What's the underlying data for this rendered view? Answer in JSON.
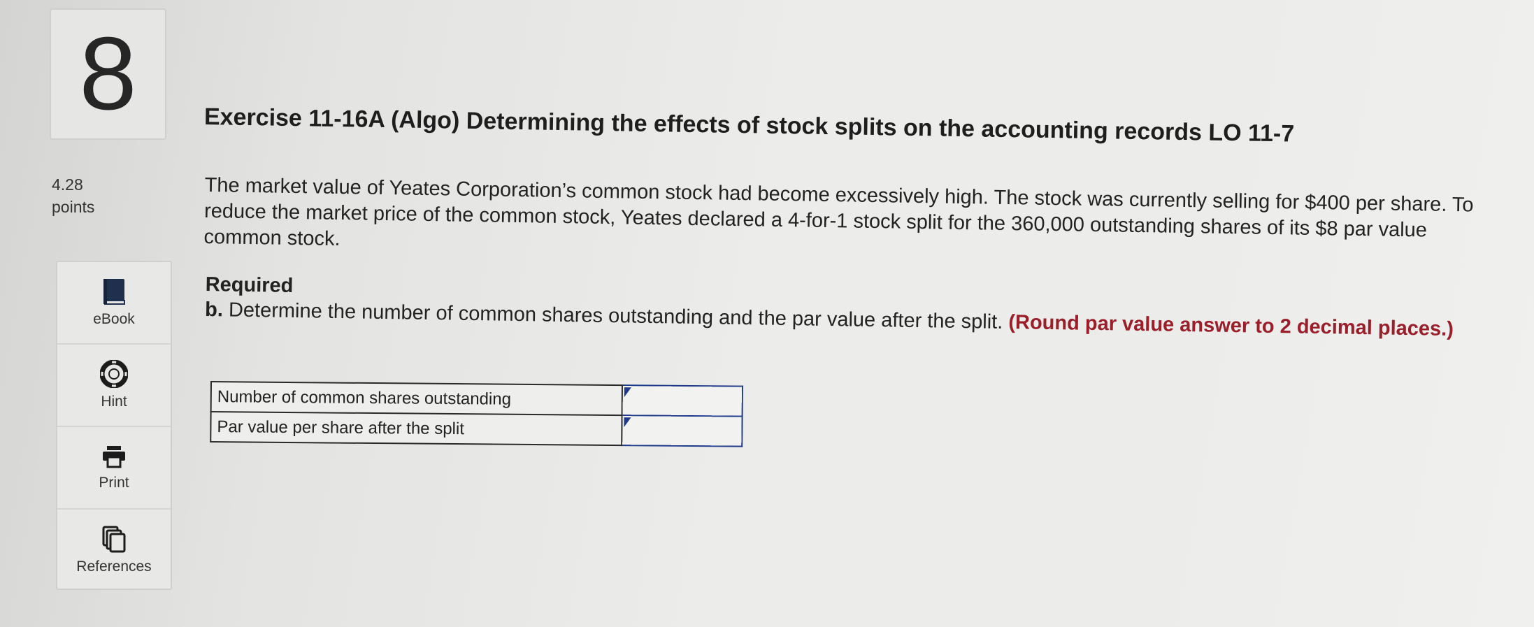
{
  "question": {
    "number": "8",
    "points_value": "4.28",
    "points_label": "points"
  },
  "tools": [
    {
      "label": "eBook",
      "icon": "book-icon"
    },
    {
      "label": "Hint",
      "icon": "lifebuoy-icon"
    },
    {
      "label": "Print",
      "icon": "printer-icon"
    },
    {
      "label": "References",
      "icon": "documents-icon"
    }
  ],
  "exercise": {
    "title": "Exercise 11-16A (Algo) Determining the effects of stock splits on the accounting records LO 11-7",
    "body": "The market value of Yeates Corporation’s common stock had become excessively high. The stock was currently selling for $400 per share. To reduce the market price of the common stock, Yeates declared a 4-for-1 stock split for the 360,000 outstanding shares of its $8 par value common stock.",
    "required_heading": "Required",
    "required_letter": "b.",
    "required_text": "Determine the number of common shares outstanding and the par value after the split.",
    "required_emphasis": "(Round par value answer to 2 decimal places.)"
  },
  "answer_table": {
    "rows": [
      {
        "label": "Number of common shares outstanding",
        "value": ""
      },
      {
        "label": "Par value per share after the split",
        "value": ""
      }
    ]
  },
  "colors": {
    "emphasis": "#9b1f2a",
    "input_border": "#1e3a8c",
    "ebook_icon": "#1f2f4e"
  }
}
